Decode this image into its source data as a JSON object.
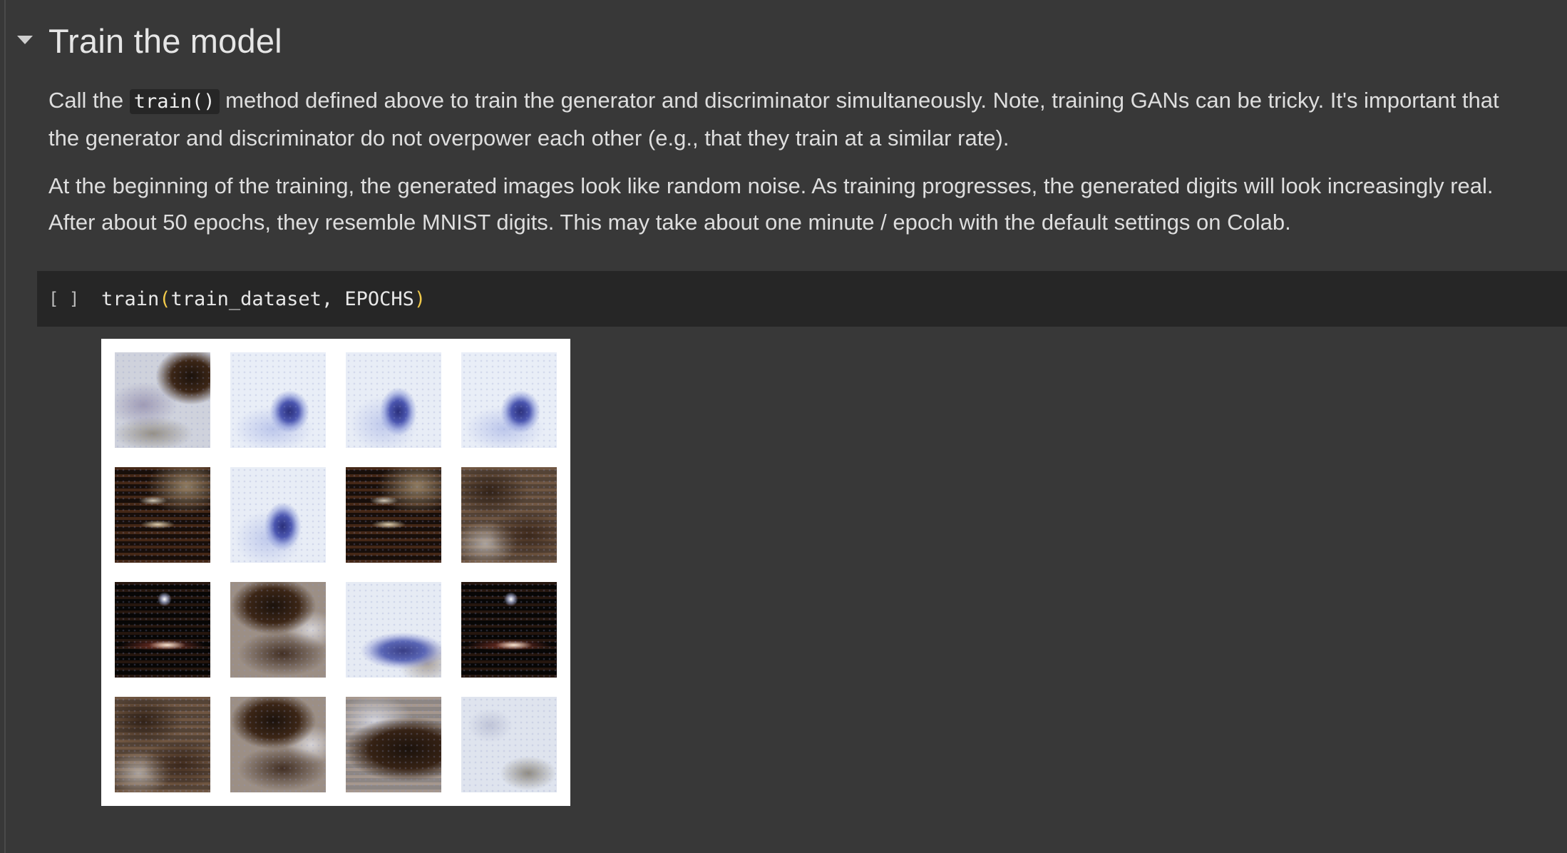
{
  "section": {
    "title": "Train the model",
    "toggle_icon": "caret-down-icon"
  },
  "text_cell": {
    "paragraph1": {
      "before_code": "Call the ",
      "inline_code": "train()",
      "after_code": " method defined above to train the generator and discriminator simultaneously. Note, training GANs can be tricky. It's important that the generator and discriminator do not overpower each other (e.g., that they train at a similar rate)."
    },
    "paragraph2": "At the beginning of the training, the generated images look like random noise. As training progresses, the generated digits will look increasingly real. After about 50 epochs, they resemble MNIST digits. This may take about one minute / epoch with the default settings on Colab."
  },
  "code_cell": {
    "run_indicator": "[ ]",
    "code_func": "train",
    "code_open_paren": "(",
    "code_args": "train_dataset, EPOCHS",
    "code_close_paren": ")"
  },
  "output": {
    "grid_rows": 4,
    "grid_cols": 4,
    "image_styles": [
      "mixed-top",
      "light-blue",
      "light-blue b2",
      "light-blue",
      "dark",
      "light-blue b2",
      "dark",
      "mixed-mid",
      "darkest",
      "mixed-blob",
      "light-blue b3",
      "darkest",
      "mixed-mid",
      "mixed-blob",
      "mixed-bottom",
      "light-faded"
    ]
  },
  "colors": {
    "background": "#383838",
    "code_background": "#262626",
    "paren": "#f0c94a",
    "text": "#dedede"
  }
}
